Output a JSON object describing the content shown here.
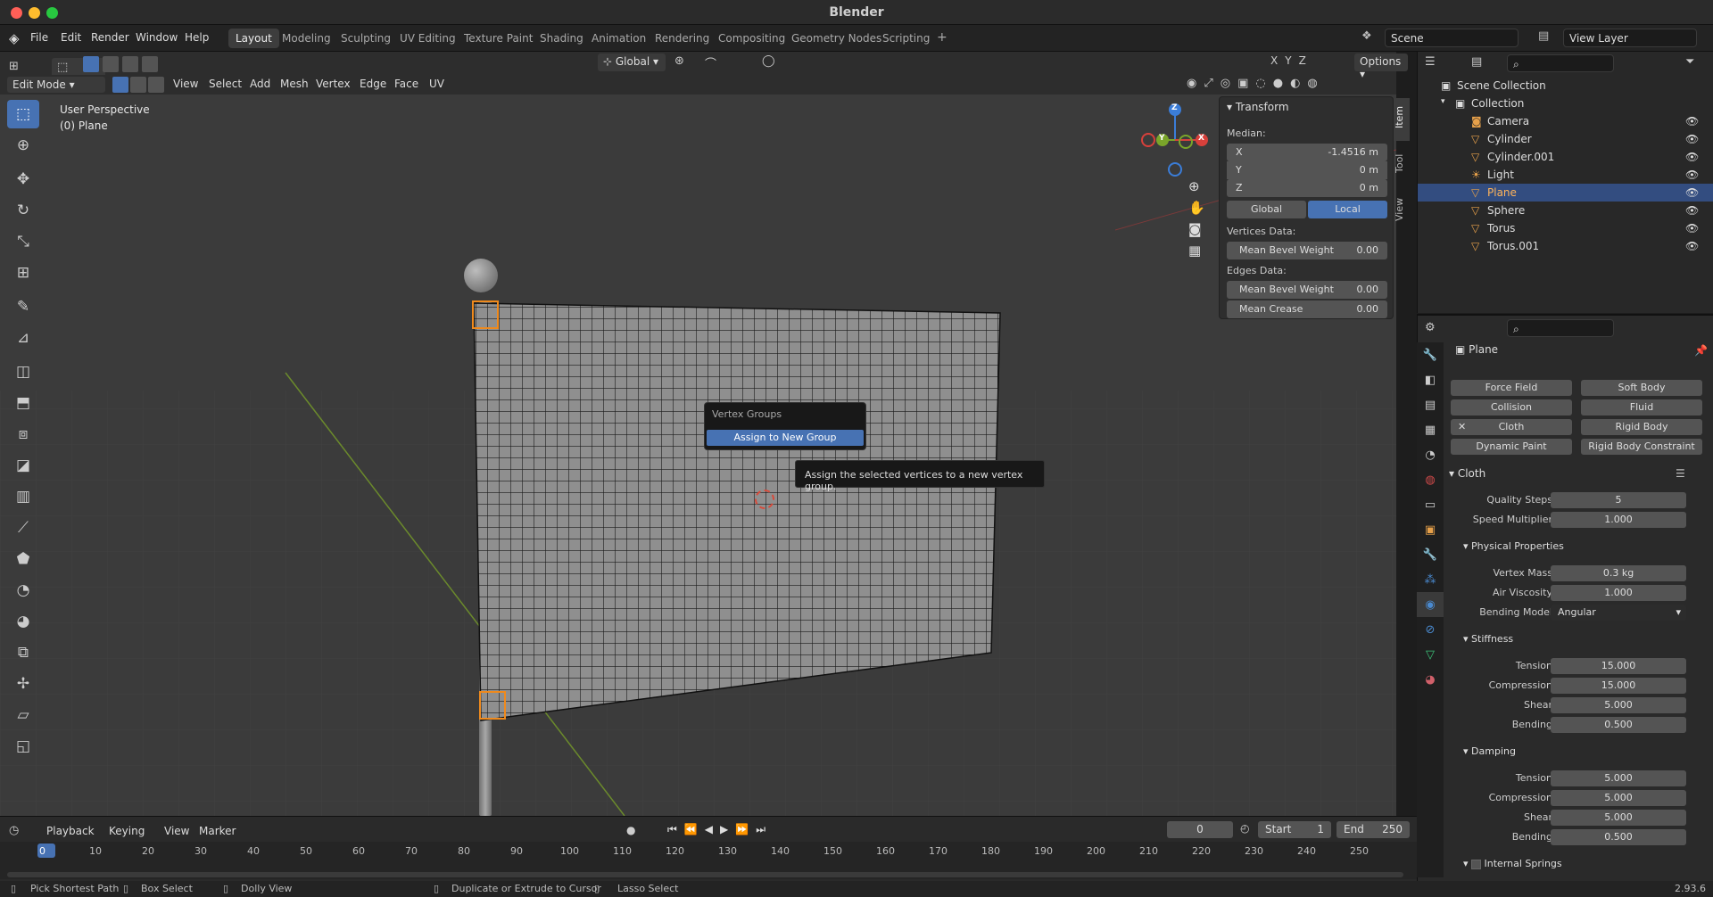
{
  "window": {
    "title": "Blender"
  },
  "menu": [
    "File",
    "Edit",
    "Render",
    "Window",
    "Help"
  ],
  "workspaces": [
    "Layout",
    "Modeling",
    "Sculpting",
    "UV Editing",
    "Texture Paint",
    "Shading",
    "Animation",
    "Rendering",
    "Compositing",
    "Geometry Nodes",
    "Scripting"
  ],
  "active_workspace": "Layout",
  "scene": {
    "name": "Scene",
    "view_layer": "View Layer"
  },
  "viewport_header": {
    "mode": "Edit Mode",
    "menus": [
      "View",
      "Select",
      "Add",
      "Mesh",
      "Vertex",
      "Edge",
      "Face",
      "UV"
    ],
    "orientation": "Global",
    "options_label": "Options",
    "axes": [
      "X",
      "Y",
      "Z"
    ]
  },
  "viewport": {
    "perspective": "User Perspective",
    "object": "(0) Plane"
  },
  "gizmo": {
    "x": "X",
    "y": "Y",
    "z": "Z"
  },
  "npanel": {
    "title": "Transform",
    "median_label": "Median:",
    "x_label": "X",
    "x_value": "-1.4516 m",
    "y_label": "Y",
    "y_value": "0 m",
    "z_label": "Z",
    "z_value": "0 m",
    "global": "Global",
    "local": "Local",
    "vertices_label": "Vertices Data:",
    "mean_bevel_weight_label": "Mean Bevel Weight",
    "vertex_bevel": "0.00",
    "edges_label": "Edges Data:",
    "edge_bevel": "0.00",
    "mean_crease_label": "Mean Crease",
    "crease": "0.00",
    "tabs": [
      "Item",
      "Tool",
      "View"
    ]
  },
  "popup": {
    "title": "Vertex Groups",
    "item": "Assign to New Group"
  },
  "tooltip": "Assign the selected vertices to a new vertex group.",
  "outliner": {
    "root": "Scene Collection",
    "collection": "Collection",
    "items": [
      "Camera",
      "Cylinder",
      "Cylinder.001",
      "Light",
      "Plane",
      "Sphere",
      "Torus",
      "Torus.001"
    ],
    "selected": "Plane"
  },
  "properties": {
    "object": "Plane",
    "physics_buttons": [
      "Force Field",
      "Soft Body",
      "Collision",
      "Fluid",
      "Cloth",
      "Rigid Body",
      "Dynamic Paint",
      "Rigid Body Constraint"
    ],
    "cloth_title": "Cloth",
    "quality_steps_label": "Quality Steps",
    "quality_steps": "5",
    "speed_multiplier_label": "Speed Multiplier",
    "speed_multiplier": "1.000",
    "physical_title": "Physical Properties",
    "vertex_mass_label": "Vertex Mass",
    "vertex_mass": "0.3 kg",
    "air_viscosity_label": "Air Viscosity",
    "air_viscosity": "1.000",
    "bending_model_label": "Bending Model",
    "bending_model": "Angular",
    "stiffness_title": "Stiffness",
    "tension_label": "Tension",
    "compression_label": "Compression",
    "shear_label": "Shear",
    "bending_label": "Bending",
    "stiff_tension": "15.000",
    "stiff_compression": "15.000",
    "stiff_shear": "5.000",
    "stiff_bending": "0.500",
    "damping_title": "Damping",
    "damp_tension": "5.000",
    "damp_compression": "5.000",
    "damp_shear": "5.000",
    "damp_bending": "0.500",
    "internal_springs": "Internal Springs"
  },
  "timeline": {
    "menus": [
      "Playback",
      "Keying",
      "View",
      "Marker"
    ],
    "current_frame": "0",
    "start_label": "Start",
    "start": "1",
    "end_label": "End",
    "end": "250",
    "ticks": [
      "0",
      "10",
      "20",
      "30",
      "40",
      "50",
      "60",
      "70",
      "80",
      "90",
      "100",
      "110",
      "120",
      "130",
      "140",
      "150",
      "160",
      "170",
      "180",
      "190",
      "200",
      "210",
      "220",
      "230",
      "240",
      "250"
    ]
  },
  "status": {
    "items": [
      "Pick Shortest Path",
      "Box Select",
      "Dolly View",
      "Duplicate or Extrude to Cursor",
      "Lasso Select"
    ],
    "version": "2.93.6"
  }
}
